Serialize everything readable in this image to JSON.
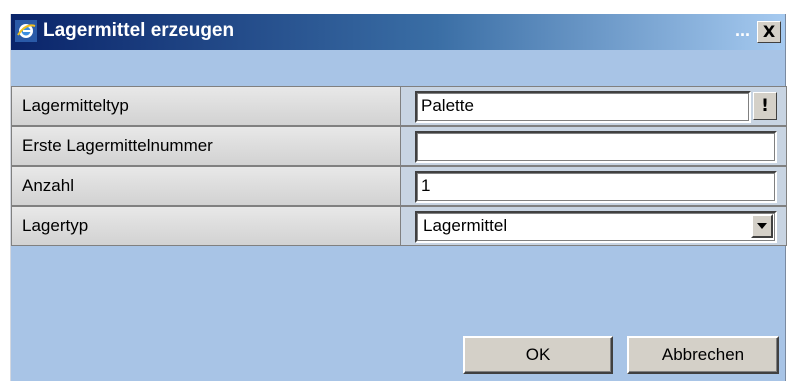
{
  "window": {
    "title": "Lagermittel erzeugen",
    "ellipsis": "...",
    "close_glyph": "X",
    "icon": "internet-explorer-icon"
  },
  "form": {
    "rows": [
      {
        "label": "Lagermitteltyp",
        "value": "Palette",
        "picker_glyph": "!"
      },
      {
        "label": "Erste Lagermittelnummer",
        "value": ""
      },
      {
        "label": "Anzahl",
        "value": "1"
      },
      {
        "label": "Lagertyp",
        "value": "Lagermittel",
        "type": "select"
      }
    ]
  },
  "buttons": {
    "ok": "OK",
    "cancel": "Abbrechen"
  },
  "colors": {
    "title_gradient_start": "#0a246a",
    "title_gradient_end": "#a6caf0",
    "window_background": "#a8c4e6",
    "button_face": "#d4d0c8"
  }
}
